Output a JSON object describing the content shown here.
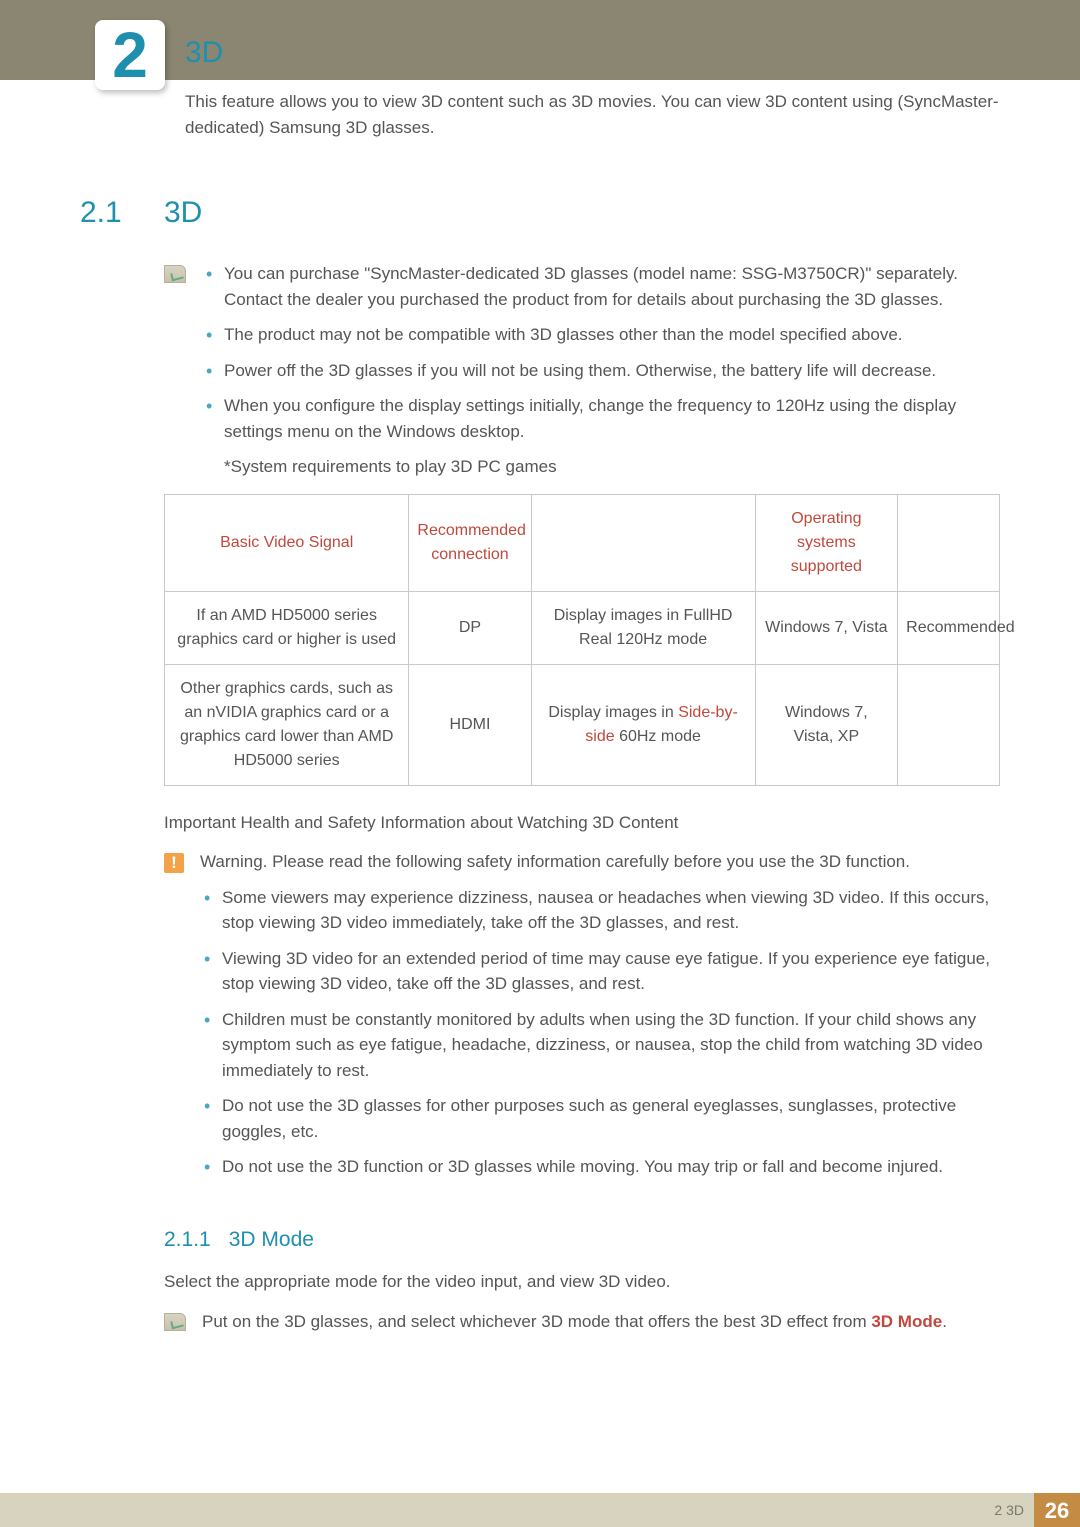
{
  "chapter": {
    "number": "2",
    "title": "3D",
    "intro": "This feature allows you to view 3D content such as 3D movies. You can view 3D content using (SyncMaster-dedicated) Samsung 3D glasses."
  },
  "section": {
    "number": "2.1",
    "title": "3D"
  },
  "note1": {
    "items": [
      "You can purchase \"SyncMaster-dedicated 3D glasses (model name: SSG-M3750CR)\" separately. Contact the dealer you purchased the product from for details about purchasing the 3D glasses.",
      "The product may not be compatible with 3D glasses other than the model specified above.",
      "Power off the 3D glasses if you will not be using them. Otherwise, the battery life will decrease.",
      "When you configure the display settings initially, change the frequency to 120Hz using the display settings menu on the Windows desktop."
    ],
    "footnote": "*System requirements to play 3D PC games"
  },
  "table": {
    "headers": {
      "basic": "Basic Video Signal",
      "conn": "Recommended connection",
      "disp": "",
      "os": "Operating systems supported",
      "rec": ""
    },
    "rows": [
      {
        "basic": "If an AMD HD5000 series graphics card or higher is used",
        "conn": "DP",
        "disp_pre": "Display images in FullHD Real 120Hz mode",
        "disp_hl": "",
        "disp_post": "",
        "os": "Windows 7, Vista",
        "rec": "Recommended"
      },
      {
        "basic": "Other graphics cards, such as an nVIDIA graphics card or a graphics card lower than AMD HD5000 series",
        "conn": "HDMI",
        "disp_pre": "Display images in ",
        "disp_hl": "Side-by-side",
        "disp_post": " 60Hz mode",
        "os": "Windows 7, Vista, XP",
        "rec": ""
      }
    ]
  },
  "safety": {
    "heading": "Important Health and Safety Information about Watching 3D Content",
    "leadin": "Warning. Please read the following safety information carefully before you use the 3D function.",
    "items": [
      "Some viewers may experience dizziness, nausea or headaches when viewing 3D video. If this occurs, stop viewing 3D video immediately, take off the 3D glasses, and rest.",
      "Viewing 3D video for an extended period of time may cause eye fatigue. If you experience eye fatigue, stop viewing 3D video, take off the 3D glasses, and rest.",
      "Children must be constantly monitored by adults when using the 3D function. If your child shows any symptom such as eye fatigue, headache, dizziness, or nausea, stop the child from watching 3D video immediately to rest.",
      "Do not use the 3D glasses for other purposes such as general eyeglasses, sunglasses, protective goggles, etc.",
      "Do not use the 3D function or 3D glasses while moving. You may trip or fall and become injured."
    ]
  },
  "subsection": {
    "number": "2.1.1",
    "title": "3D Mode",
    "body": "Select the appropriate mode for the video input, and view 3D video.",
    "tip_pre": "Put on the 3D glasses, and select whichever 3D mode that offers the best 3D effect from ",
    "tip_hl": "3D Mode",
    "tip_post": "."
  },
  "footer": {
    "crumb": "2 3D",
    "page": "26"
  }
}
